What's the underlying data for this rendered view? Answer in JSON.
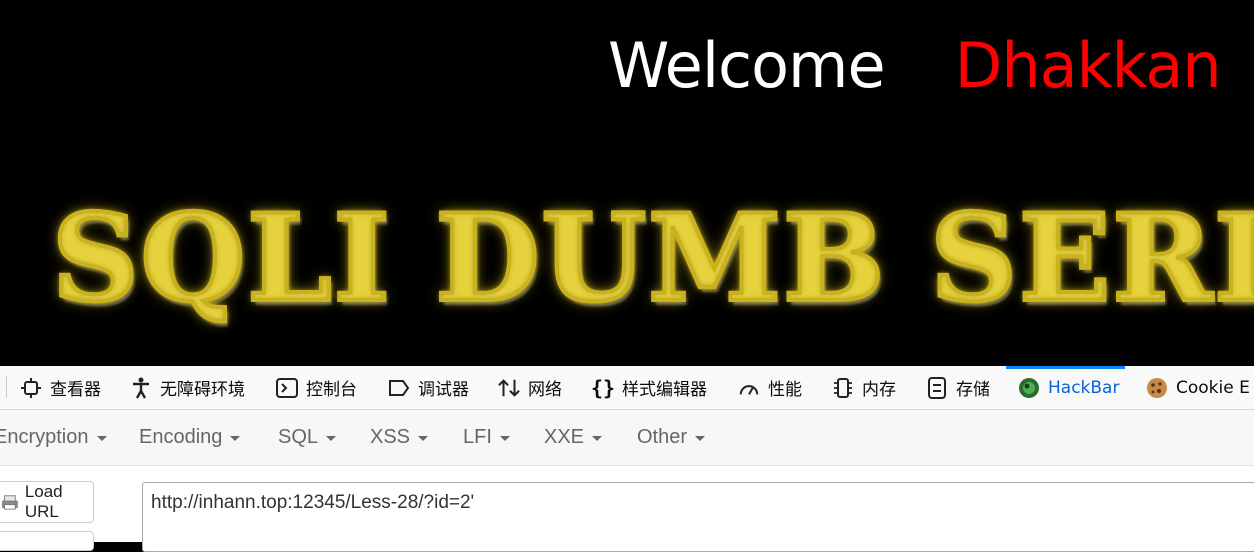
{
  "banner": {
    "welcome": "Welcome",
    "name": "Dhakkan",
    "logo_text": "SQLI DUMB SERIES"
  },
  "devtools": {
    "tabs": [
      {
        "label": "查看器",
        "icon": "inspector-icon"
      },
      {
        "label": "无障碍环境",
        "icon": "accessibility-icon"
      },
      {
        "label": "控制台",
        "icon": "console-icon"
      },
      {
        "label": "调试器",
        "icon": "debugger-icon"
      },
      {
        "label": "网络",
        "icon": "network-icon"
      },
      {
        "label": "样式编辑器",
        "icon": "style-editor-icon"
      },
      {
        "label": "性能",
        "icon": "performance-icon"
      },
      {
        "label": "内存",
        "icon": "memory-icon"
      },
      {
        "label": "存储",
        "icon": "storage-icon"
      },
      {
        "label": "HackBar",
        "icon": "hackbar-icon",
        "active": true
      },
      {
        "label": "Cookie E",
        "icon": "cookie-icon"
      }
    ]
  },
  "hackbar": {
    "menu": [
      "Encryption",
      "Encoding",
      "SQL",
      "XSS",
      "LFI",
      "XXE",
      "Other"
    ],
    "load_url": "Load URL",
    "url_value": "http://inhann.top:12345/Less-28/?id=2'"
  },
  "colors": {
    "welcome": "#ffffff",
    "name": "#ff0000",
    "active_tab": "#0a84ff"
  }
}
